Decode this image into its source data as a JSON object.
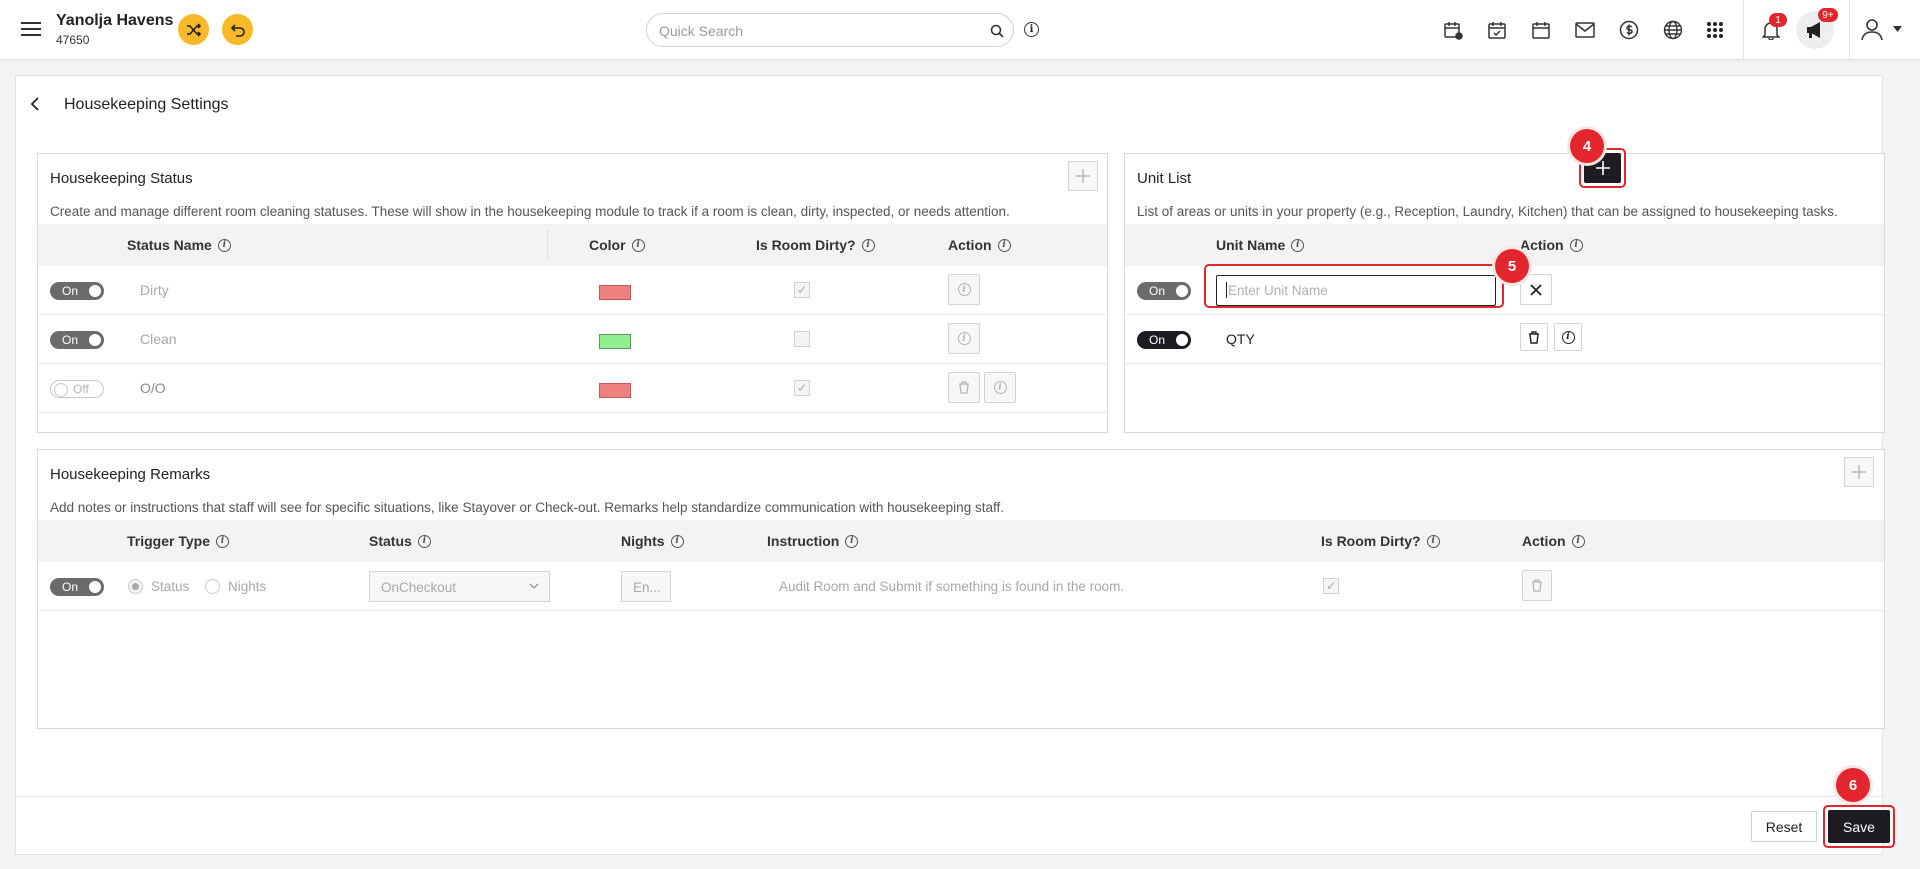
{
  "header": {
    "property_name": "Yanolja Havens",
    "property_id": "47650",
    "search_placeholder": "Quick Search",
    "notification_count": "1",
    "announcement_count": "9+"
  },
  "page": {
    "title": "Housekeeping Settings"
  },
  "status_card": {
    "title": "Housekeeping Status",
    "description": "Create and manage different room cleaning statuses. These will show in the housekeeping module to track if a room is clean, dirty, inspected, or needs attention.",
    "columns": [
      "Status Name",
      "Color",
      "Is Room Dirty?",
      "Action"
    ],
    "rows": [
      {
        "toggle": "On",
        "name": "Dirty",
        "color": "#f08080",
        "dirty": true
      },
      {
        "toggle": "On",
        "name": "Clean",
        "color": "#90ee90",
        "dirty": false
      },
      {
        "toggle": "Off",
        "name": "O/O",
        "color": "#f08080",
        "dirty": true
      }
    ]
  },
  "unit_card": {
    "title": "Unit List",
    "description": "List of areas or units in your property (e.g., Reception, Laundry, Kitchen) that can be assigned to housekeeping tasks.",
    "columns": [
      "Unit Name",
      "Action"
    ],
    "rows": [
      {
        "toggle": "On",
        "input_placeholder": "Enter Unit Name"
      },
      {
        "toggle": "On",
        "name": "QTY"
      }
    ]
  },
  "remarks_card": {
    "title": "Housekeeping Remarks",
    "description": "Add notes or instructions that staff will see for specific situations, like Stayover or Check-out. Remarks help standardize communication with housekeeping staff.",
    "columns": [
      "Trigger Type",
      "Status",
      "Nights",
      "Instruction",
      "Is Room Dirty?",
      "Action"
    ],
    "row": {
      "toggle": "On",
      "trigger_status": "Status",
      "trigger_nights": "Nights",
      "status_value": "OnCheckout",
      "nights_placeholder": "En...",
      "instruction": "Audit Room and Submit if something is found in the room."
    }
  },
  "footer": {
    "reset_label": "Reset",
    "save_label": "Save"
  },
  "annotations": {
    "step_4": "4",
    "step_5": "5",
    "step_6": "6"
  },
  "colors": {
    "accent_yellow": "#f7b928",
    "dark": "#1c1c22",
    "highlight_red": "#e3262d"
  }
}
